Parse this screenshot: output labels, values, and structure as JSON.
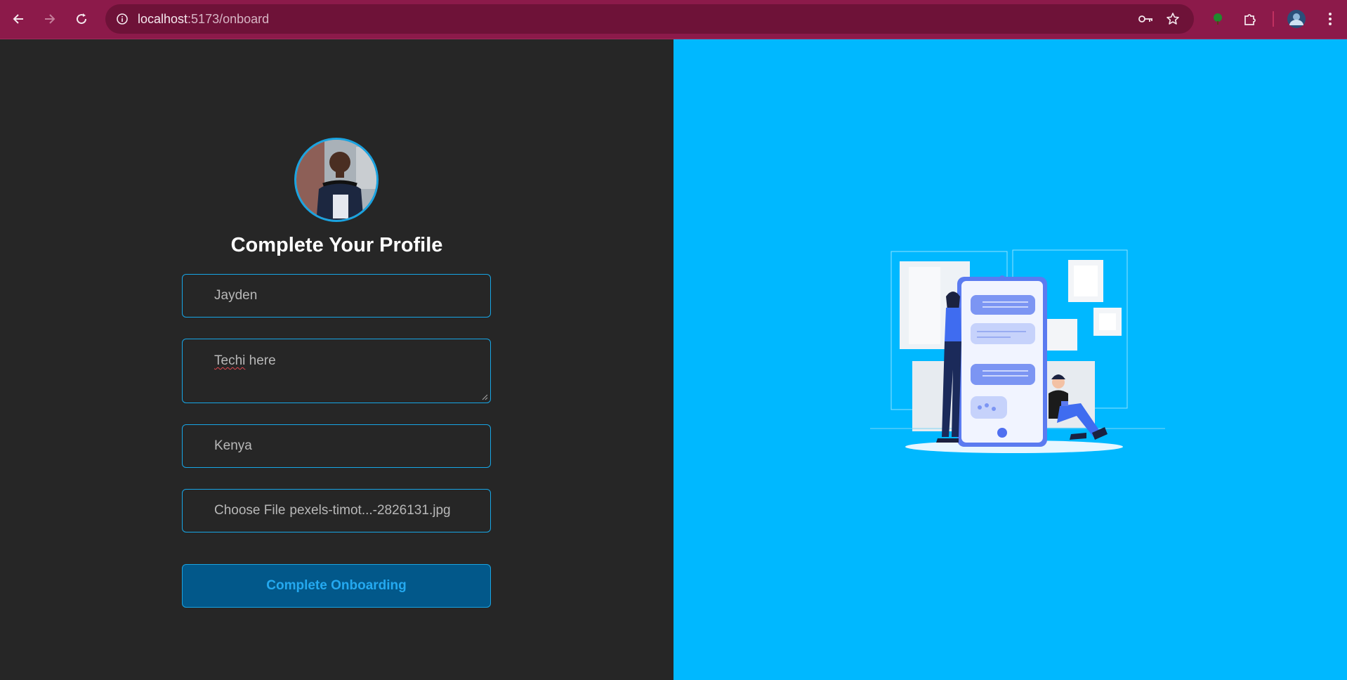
{
  "browser": {
    "url_host": "localhost",
    "url_path": ":5173/onboard",
    "icons": [
      "back-arrow-icon",
      "forward-arrow-icon",
      "reload-icon",
      "site-info-icon",
      "password-key-icon",
      "bookmark-star-icon",
      "extension-tree-icon",
      "extensions-puzzle-icon",
      "profile-avatar",
      "more-menu-icon"
    ]
  },
  "form": {
    "title": "Complete Your Profile",
    "first_name_value": "Jayden",
    "bio_word1": "Techi",
    "bio_word2": " here",
    "country_value": "Kenya",
    "file_button": "Choose File",
    "file_name": "pexels-timot...-2826131.jpg",
    "submit_label": "Complete Onboarding"
  },
  "colors": {
    "chrome": "#8c1a4a",
    "left_bg": "#262626",
    "right_bg": "#00b8ff",
    "accent": "#17a6e6",
    "button_bg": "#02588a"
  }
}
